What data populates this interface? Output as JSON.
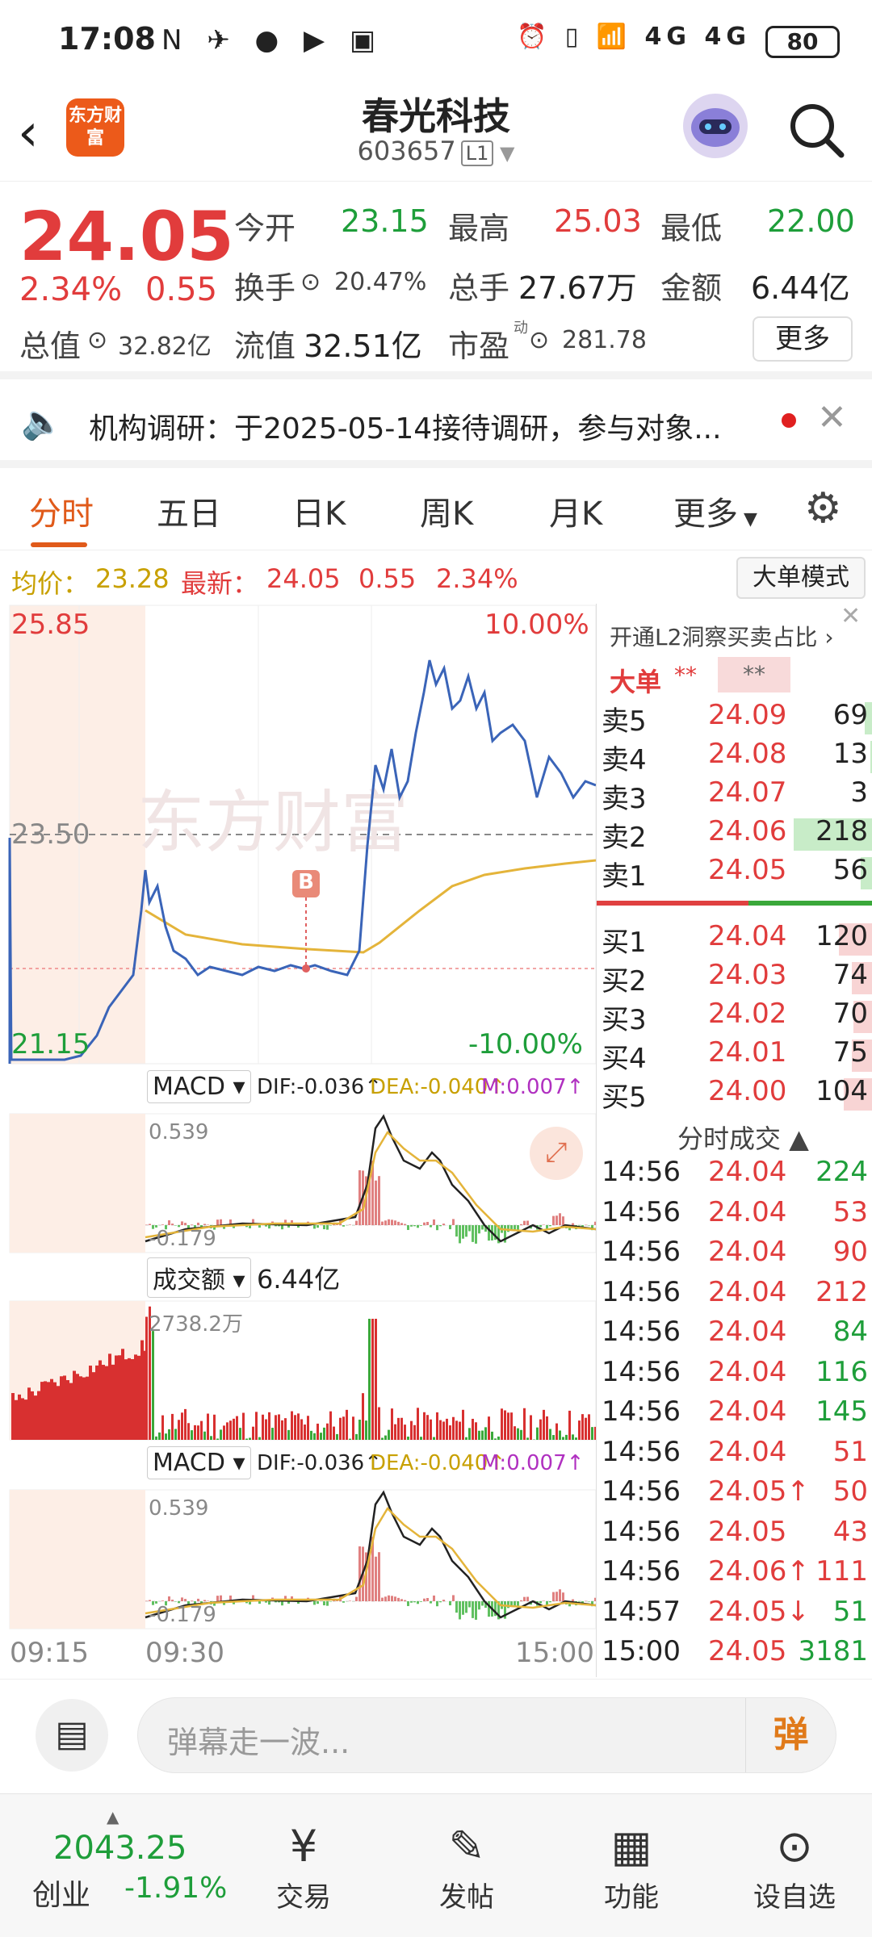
{
  "status_bar": {
    "time": "17:08",
    "battery": "80",
    "left_icons": "N ✈ ● ▶ ▣",
    "right_icons": "⏰ ▯ 📶 4G 4G"
  },
  "title": {
    "name": "春光科技",
    "code": "603657",
    "level": "L1",
    "logo_text": "东方财富"
  },
  "quote": {
    "price": "24.05",
    "change_pct": "2.34%",
    "change": "0.55",
    "open_label": "今开",
    "open": "23.15",
    "high_label": "最高",
    "high": "25.03",
    "low_label": "最低",
    "low": "22.00",
    "turnover_label": "换手",
    "turnover": "20.47%",
    "volume_label": "总手",
    "volume": "27.67万",
    "amount_label": "金额",
    "amount": "6.44亿",
    "mktcap_label": "总值",
    "mktcap": "32.82亿",
    "float_label": "流值",
    "float_cap": "32.51亿",
    "pe_label": "市盈",
    "pe_sup": "动",
    "pe": "281.78",
    "more_button": "更多"
  },
  "notice": {
    "text": "机构调研：于2025-05-14接待调研，参与对象..."
  },
  "tabs": [
    "分时",
    "五日",
    "日K",
    "周K",
    "月K",
    "更多"
  ],
  "info_line": {
    "avg_label": "均价：",
    "avg": "23.28",
    "latest_label": "最新：",
    "latest": "24.05",
    "change": "0.55",
    "pct": "2.34%",
    "big_order_button": "大单模式"
  },
  "chart": {
    "price_top": "25.85",
    "price_mid": "23.50",
    "price_bottom": "21.15",
    "pct_top": "10.00%",
    "pct_bottom": "-10.00%",
    "watermark": "东方财富",
    "marker": "B",
    "macd_label": "MACD",
    "dif": "DIF:-0.036↑",
    "dea": "DEA:-0.040↑",
    "m": "M:0.007↑",
    "macd_top": "0.539",
    "macd_bottom": "-0.179",
    "amount_label": "成交额",
    "amount_value": "6.44亿",
    "amount_max": "2738.2万",
    "time_labels": [
      "09:15",
      "09:30",
      "15:00"
    ],
    "colors": {
      "price_line": "#3a64b8",
      "avg_line": "#e4b43a",
      "up": "#e13c3c",
      "down": "#3aa83a"
    }
  },
  "order_book": {
    "l2_text": "开通L2洞察买卖占比",
    "big_order": "大单",
    "asks": [
      {
        "label": "卖5",
        "price": "24.09",
        "vol": "69",
        "ratio": 0.1
      },
      {
        "label": "卖4",
        "price": "24.08",
        "vol": "13",
        "ratio": 0.03
      },
      {
        "label": "卖3",
        "price": "24.07",
        "vol": "3",
        "ratio": 0.01
      },
      {
        "label": "卖2",
        "price": "24.06",
        "vol": "218",
        "ratio": 0.98
      },
      {
        "label": "卖1",
        "price": "24.05",
        "vol": "56",
        "ratio": 0.15
      }
    ],
    "bids": [
      {
        "label": "买1",
        "price": "24.04",
        "vol": "120",
        "ratio": 0.42
      },
      {
        "label": "买2",
        "price": "24.03",
        "vol": "74",
        "ratio": 0.26
      },
      {
        "label": "买3",
        "price": "24.02",
        "vol": "70",
        "ratio": 0.24
      },
      {
        "label": "买4",
        "price": "24.01",
        "vol": "75",
        "ratio": 0.26
      },
      {
        "label": "买5",
        "price": "24.00",
        "vol": "104",
        "ratio": 0.36
      }
    ],
    "ticks_title": "分时成交",
    "ticks": [
      {
        "time": "14:56",
        "price": "24.04",
        "vol": "224",
        "dir": "down"
      },
      {
        "time": "14:56",
        "price": "24.04",
        "vol": "53",
        "dir": "up"
      },
      {
        "time": "14:56",
        "price": "24.04",
        "vol": "90",
        "dir": "up"
      },
      {
        "time": "14:56",
        "price": "24.04",
        "vol": "212",
        "dir": "up"
      },
      {
        "time": "14:56",
        "price": "24.04",
        "vol": "84",
        "dir": "down"
      },
      {
        "time": "14:56",
        "price": "24.04",
        "vol": "116",
        "dir": "down"
      },
      {
        "time": "14:56",
        "price": "24.04",
        "vol": "145",
        "dir": "down"
      },
      {
        "time": "14:56",
        "price": "24.04",
        "vol": "51",
        "dir": "up"
      },
      {
        "time": "14:56",
        "price": "24.05↑",
        "vol": "50",
        "dir": "up"
      },
      {
        "time": "14:56",
        "price": "24.05",
        "vol": "43",
        "dir": "up"
      },
      {
        "time": "14:56",
        "price": "24.06↑",
        "vol": "111",
        "dir": "up"
      },
      {
        "time": "14:57",
        "price": "24.05↓",
        "vol": "51",
        "dir": "down"
      },
      {
        "time": "15:00",
        "price": "24.05",
        "vol": "3181",
        "dir": "down"
      }
    ]
  },
  "danmu": {
    "placeholder": "弹幕走一波...",
    "button": "弹"
  },
  "bottom_nav": {
    "index_value": "2043.25",
    "index_name": "创业",
    "index_change": "-1.91%",
    "items": [
      {
        "label": "交易",
        "icon": "trade-icon"
      },
      {
        "label": "发帖",
        "icon": "post-icon"
      },
      {
        "label": "功能",
        "icon": "apps-icon"
      },
      {
        "label": "设自选",
        "icon": "add-watchlist-icon"
      }
    ]
  }
}
